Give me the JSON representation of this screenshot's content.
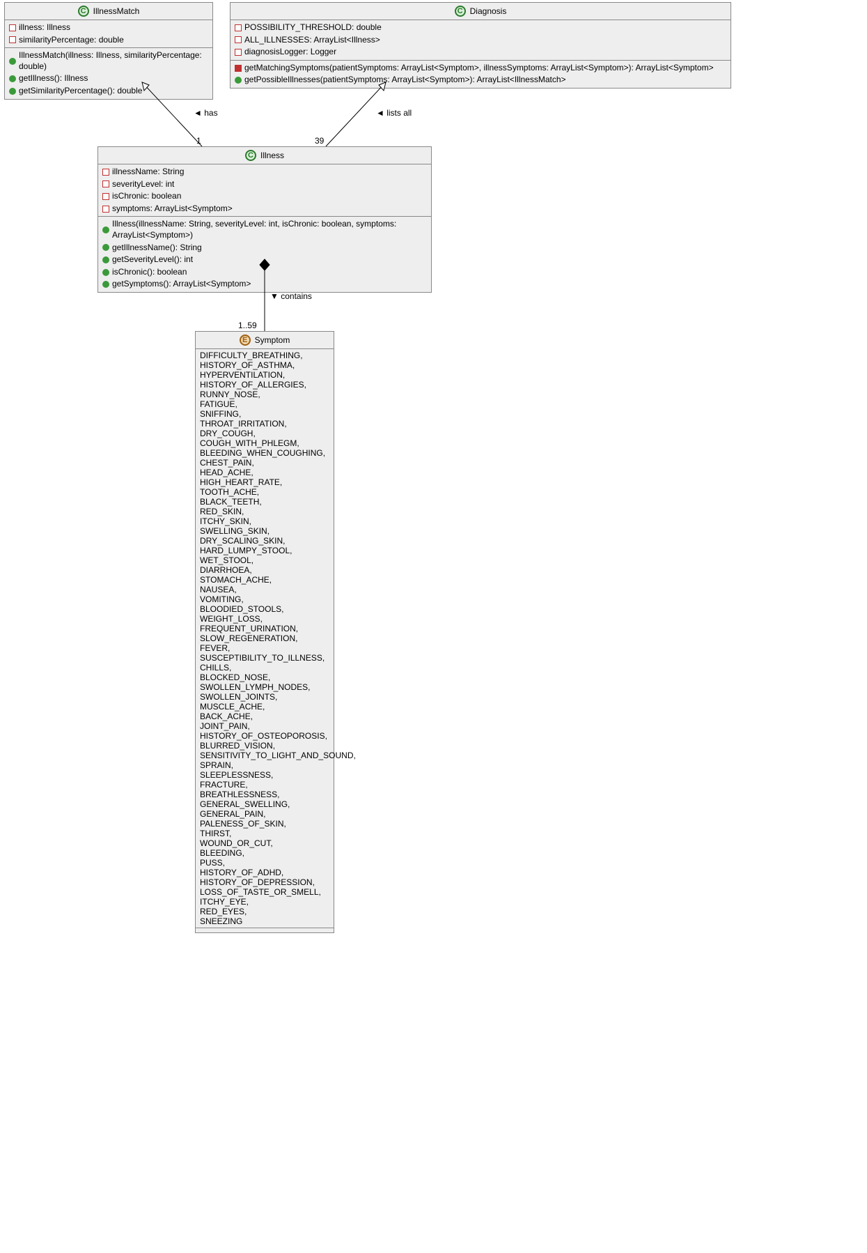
{
  "classes": {
    "illnessMatch": {
      "name": "IllnessMatch",
      "stereotype": "C",
      "fields": [
        {
          "vis": "private",
          "text": "illness: Illness"
        },
        {
          "vis": "private",
          "text": "similarityPercentage: double"
        }
      ],
      "methods": [
        {
          "vis": "public",
          "text": "IllnessMatch(illness: Illness, similarityPercentage: double)"
        },
        {
          "vis": "public",
          "text": "getIllness(): Illness"
        },
        {
          "vis": "public",
          "text": "getSimilarityPercentage(): double"
        }
      ]
    },
    "diagnosis": {
      "name": "Diagnosis",
      "stereotype": "C",
      "fields": [
        {
          "vis": "private",
          "text": "POSSIBILITY_THRESHOLD: double"
        },
        {
          "vis": "private",
          "text": "ALL_ILLNESSES: ArrayList<Illness>"
        },
        {
          "vis": "private",
          "text": "diagnosisLogger: Logger"
        }
      ],
      "methods": [
        {
          "vis": "protected",
          "text": "getMatchingSymptoms(patientSymptoms: ArrayList<Symptom>, illnessSymptoms: ArrayList<Symptom>): ArrayList<Symptom>"
        },
        {
          "vis": "public",
          "text": "getPossibleIllnesses(patientSymptoms: ArrayList<Symptom>): ArrayList<IllnessMatch>"
        }
      ]
    },
    "illness": {
      "name": "Illness",
      "stereotype": "C",
      "fields": [
        {
          "vis": "private",
          "text": "illnessName: String"
        },
        {
          "vis": "private",
          "text": "severityLevel: int"
        },
        {
          "vis": "private",
          "text": "isChronic: boolean"
        },
        {
          "vis": "private",
          "text": "symptoms: ArrayList<Symptom>"
        }
      ],
      "methods": [
        {
          "vis": "public",
          "text": "Illness(illnessName: String, severityLevel: int, isChronic: boolean, symptoms: ArrayList<Symptom>)"
        },
        {
          "vis": "public",
          "text": "getIllnessName(): String"
        },
        {
          "vis": "public",
          "text": "getSeverityLevel(): int"
        },
        {
          "vis": "public",
          "text": "isChronic(): boolean"
        },
        {
          "vis": "public",
          "text": "getSymptoms(): ArrayList<Symptom>"
        }
      ]
    },
    "symptom": {
      "name": "Symptom",
      "stereotype": "E",
      "values": [
        "DIFFICULTY_BREATHING,",
        "HISTORY_OF_ASTHMA,",
        "HYPERVENTILATION,",
        "HISTORY_OF_ALLERGIES,",
        "RUNNY_NOSE,",
        "FATIGUE,",
        "SNIFFING,",
        "THROAT_IRRITATION,",
        "DRY_COUGH,",
        "COUGH_WITH_PHLEGM,",
        "BLEEDING_WHEN_COUGHING,",
        "CHEST_PAIN,",
        "HEAD_ACHE,",
        "HIGH_HEART_RATE,",
        "TOOTH_ACHE,",
        "BLACK_TEETH,",
        "RED_SKIN,",
        "ITCHY_SKIN,",
        "SWELLING_SKIN,",
        "DRY_SCALING_SKIN,",
        "HARD_LUMPY_STOOL,",
        "WET_STOOL,",
        "DIARRHOEA,",
        "STOMACH_ACHE,",
        "NAUSEA,",
        "VOMITING,",
        "BLOODIED_STOOLS,",
        "WEIGHT_LOSS,",
        "FREQUENT_URINATION,",
        "SLOW_REGENERATION,",
        "FEVER,",
        "SUSCEPTIBILITY_TO_ILLNESS,",
        "CHILLS,",
        "BLOCKED_NOSE,",
        "SWOLLEN_LYMPH_NODES,",
        "SWOLLEN_JOINTS,",
        "MUSCLE_ACHE,",
        "BACK_ACHE,",
        "JOINT_PAIN,",
        "HISTORY_OF_OSTEOPOROSIS,",
        "BLURRED_VISION,",
        "SENSITIVITY_TO_LIGHT_AND_SOUND,",
        "SPRAIN,",
        "SLEEPLESSNESS,",
        "FRACTURE,",
        "BREATHLESSNESS,",
        "GENERAL_SWELLING,",
        "GENERAL_PAIN,",
        "PALENESS_OF_SKIN,",
        "THIRST,",
        "WOUND_OR_CUT,",
        "BLEEDING,",
        "PUSS,",
        "HISTORY_OF_ADHD,",
        "HISTORY_OF_DEPRESSION,",
        "LOSS_OF_TASTE_OR_SMELL,",
        "ITCHY_EYE,",
        "RED_EYES,",
        "SNEEZING"
      ]
    }
  },
  "relations": {
    "has": {
      "label": "has",
      "mult": "1"
    },
    "listsAll": {
      "label": "lists all",
      "mult": "39"
    },
    "contains": {
      "label": "contains",
      "mult": "1..59"
    }
  }
}
